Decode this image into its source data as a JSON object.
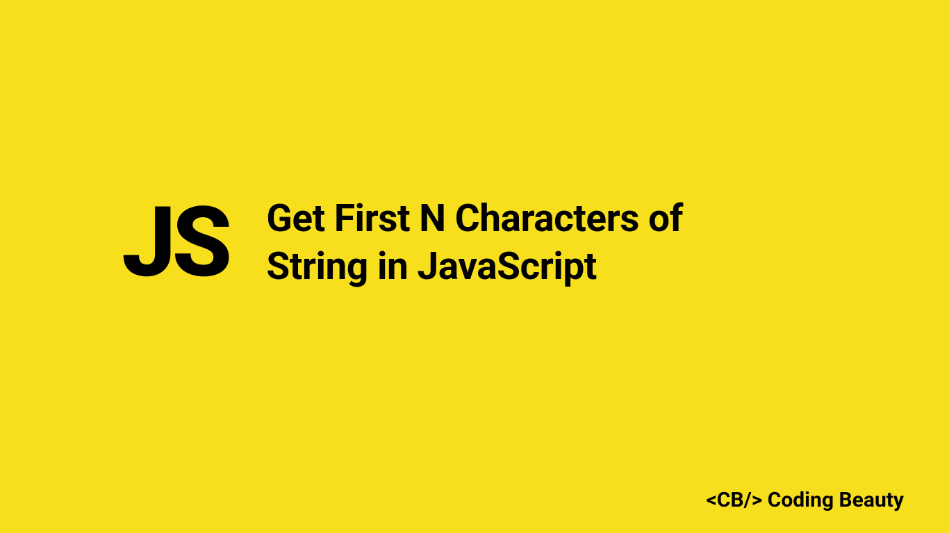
{
  "hero": {
    "logo_text": "JS",
    "title_line1": "Get First N Characters of",
    "title_line2": "String in JavaScript"
  },
  "footer": {
    "brand": "<CB/> Coding Beauty"
  },
  "colors": {
    "background": "#f7df1e",
    "text": "#000000"
  }
}
